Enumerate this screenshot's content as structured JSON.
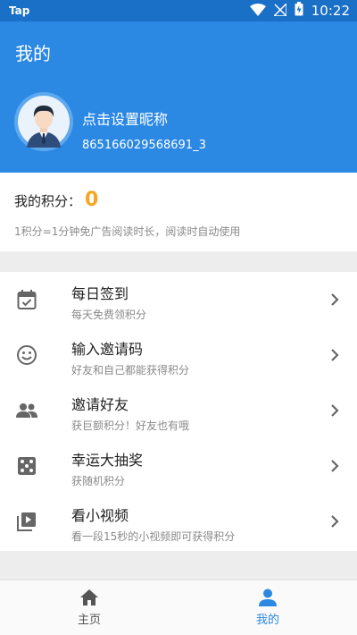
{
  "status_bar": {
    "app_label": "Tap",
    "time": "10:22"
  },
  "header": {
    "title": "我的",
    "nickname": "点击设置昵称",
    "user_id": "865166029568691_3"
  },
  "points": {
    "label": "我的积分：",
    "value": "0",
    "description": "1积分=1分钟免广告阅读时长，阅读时自动使用"
  },
  "menu": {
    "items": [
      {
        "icon": "calendar-check-icon",
        "title": "每日签到",
        "subtitle": "每天免费领积分"
      },
      {
        "icon": "smiley-icon",
        "title": "输入邀请码",
        "subtitle": "好友和自己都能获得积分"
      },
      {
        "icon": "group-icon",
        "title": "邀请好友",
        "subtitle": "获巨额积分！好友也有哦"
      },
      {
        "icon": "dice-icon",
        "title": "幸运大抽奖",
        "subtitle": "获随机积分"
      },
      {
        "icon": "video-library-icon",
        "title": "看小视频",
        "subtitle": "看一段15秒的小视频即可获得积分"
      }
    ]
  },
  "bottom_nav": {
    "tabs": [
      {
        "label": "主页",
        "icon": "home-icon",
        "active": false
      },
      {
        "label": "我的",
        "icon": "person-icon",
        "active": true
      }
    ]
  },
  "colors": {
    "status_bar": "#1a6fc7",
    "header": "#2b88e3",
    "points_value": "#f5a623",
    "active_tab": "#2b88e3"
  }
}
